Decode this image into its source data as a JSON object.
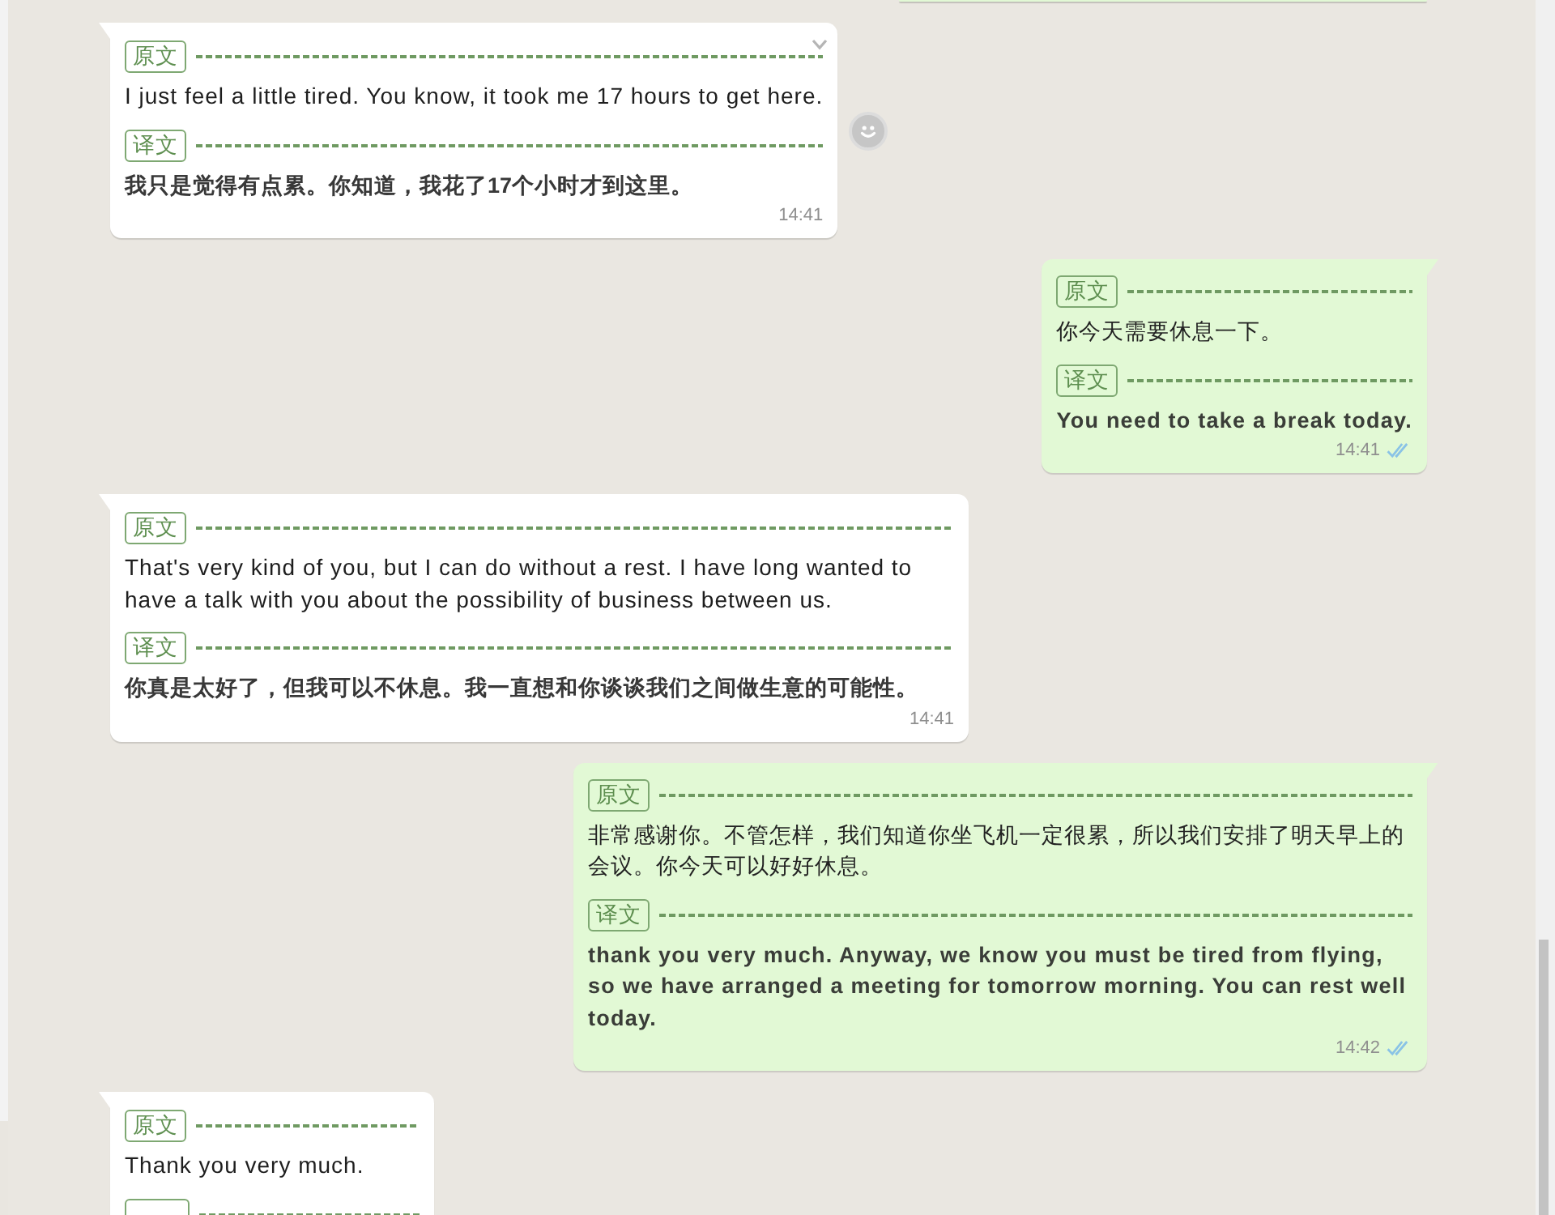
{
  "messages": [
    {
      "outgoing": false,
      "hovered": true,
      "original_tag": "原文",
      "original": "I just feel a little tired. You know, it took me 17 hours to get here.",
      "translation_tag": "译文",
      "translation": "我只是觉得有点累。你知道，我花了17个小时才到这里。",
      "time": "14:41"
    },
    {
      "outgoing": true,
      "hovered": false,
      "original_tag": "原文",
      "original": "你今天需要休息一下。",
      "translation_tag": "译文",
      "translation": "You need to take a break today.",
      "time": "14:41",
      "read": true
    },
    {
      "outgoing": false,
      "hovered": false,
      "original_tag": "原文",
      "original": "That's very kind of you, but I can do without a rest. I have long wanted to have a talk with you about the possibility of business between us.",
      "translation_tag": "译文",
      "translation": "你真是太好了，但我可以不休息。我一直想和你谈谈我们之间做生意的可能性。",
      "time": "14:41"
    },
    {
      "outgoing": true,
      "hovered": false,
      "original_tag": "原文",
      "original": "非常感谢你。不管怎样，我们知道你坐飞机一定很累，所以我们安排了明天早上的会议。你今天可以好好休息。",
      "translation_tag": "译文",
      "translation": "thank you very much. Anyway, we know you must be tired from flying, so we have arranged a meeting for tomorrow morning. You can rest well today.",
      "time": "14:42",
      "read": true
    },
    {
      "outgoing": false,
      "hovered": false,
      "original_tag": "原文",
      "original": "Thank you very much.",
      "truncated": true
    }
  ]
}
